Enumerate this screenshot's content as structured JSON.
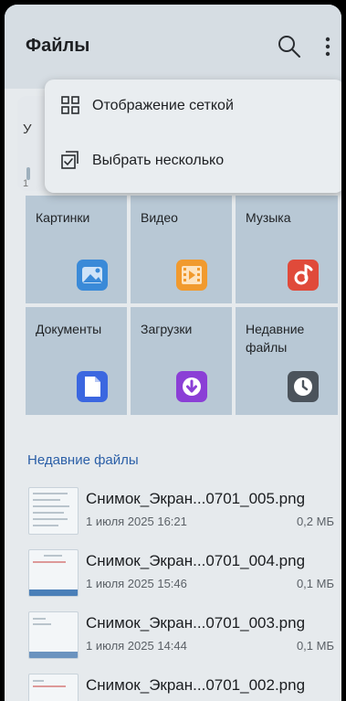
{
  "header": {
    "title": "Файлы"
  },
  "menu": {
    "items": [
      {
        "label": "Отображение сеткой",
        "icon": "grid-icon"
      },
      {
        "label": "Выбрать несколько",
        "icon": "multi-select-icon"
      }
    ]
  },
  "storage_card": {
    "peek_text": "У",
    "peek_small": "1"
  },
  "categories": [
    {
      "label": "Картинки",
      "icon": "image-icon",
      "color": "#3a8ad8"
    },
    {
      "label": "Видео",
      "icon": "video-icon",
      "color": "#f19a2e"
    },
    {
      "label": "Музыка",
      "icon": "music-icon",
      "color": "#e04a3a"
    },
    {
      "label": "Документы",
      "icon": "document-icon",
      "color": "#3b67e0"
    },
    {
      "label": "Загрузки",
      "icon": "download-icon",
      "color": "#8b3fd6"
    },
    {
      "label": "Недавние файлы",
      "icon": "clock-icon",
      "color": "#4b535b"
    }
  ],
  "recent": {
    "title": "Недавние файлы",
    "files": [
      {
        "name": "Снимок_Экран...0701_005.png",
        "date": "1 июля 2025 16:21",
        "size": "0,2 МБ"
      },
      {
        "name": "Снимок_Экран...0701_004.png",
        "date": "1 июля 2025 15:46",
        "size": "0,1 МБ"
      },
      {
        "name": "Снимок_Экран...0701_003.png",
        "date": "1 июля 2025 14:44",
        "size": "0,1 МБ"
      },
      {
        "name": "Снимок_Экран...0701_002.png",
        "date": "",
        "size": ""
      }
    ]
  }
}
